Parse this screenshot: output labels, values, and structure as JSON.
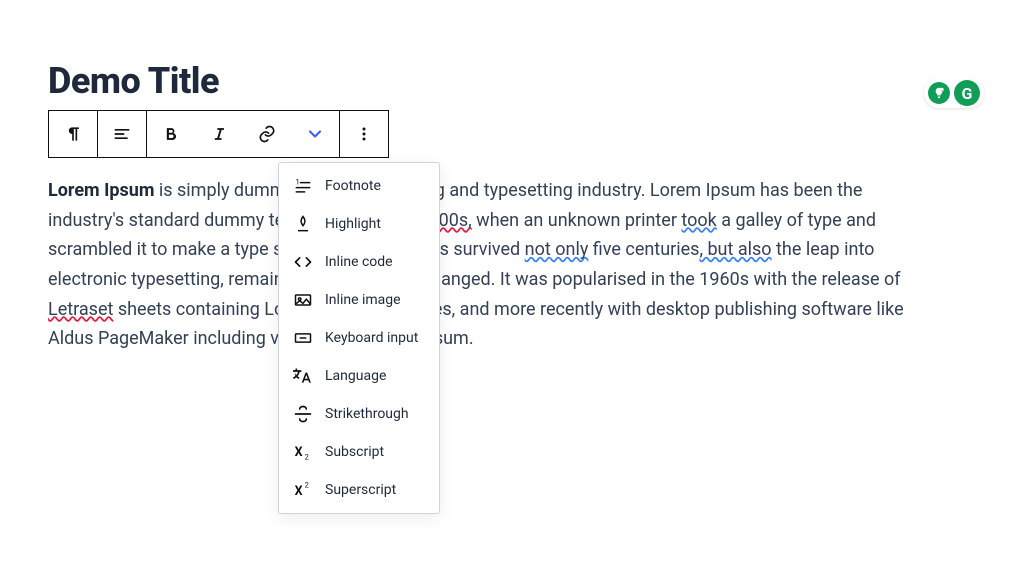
{
  "title": "Demo Title",
  "toolbar": {
    "paragraph_btn": "Paragraph",
    "align_btn": "Align",
    "bold_btn": "Bold",
    "italic_btn": "Italic",
    "link_btn": "Link",
    "more_format_btn": "More formatting",
    "overflow_btn": "Options"
  },
  "body": {
    "lead": "Lorem Ipsum",
    "t1": " is simply dummy text of the printing and typesetting industry. Lorem Ipsum has been the industry's standard dummy text ever since the ",
    "w1": "1500s,",
    "t2": " when an unknown printer ",
    "w2": "took",
    "t3": " a galley of type and scrambled it to make a type specimen book. It has survived ",
    "w3": "not only",
    "t4": " five centuries",
    "w4": ", but also",
    "t5": " the leap into electronic typesetting, remaining essentially unchanged. It was popularised in the 1960s with the release of ",
    "w5": "Letraset",
    "t6": " sheets containing Lorem Ipsum passages, and more recently with desktop publishing software like Aldus PageMaker including versions of Lorem Ipsum."
  },
  "menu": {
    "items": [
      {
        "id": "footnote",
        "label": "Footnote"
      },
      {
        "id": "highlight",
        "label": "Highlight"
      },
      {
        "id": "inline-code",
        "label": "Inline code"
      },
      {
        "id": "inline-image",
        "label": "Inline image"
      },
      {
        "id": "keyboard",
        "label": "Keyboard input"
      },
      {
        "id": "language",
        "label": "Language"
      },
      {
        "id": "strikethrough",
        "label": "Strikethrough"
      },
      {
        "id": "subscript",
        "label": "Subscript"
      },
      {
        "id": "superscript",
        "label": "Superscript"
      }
    ]
  },
  "badges": {
    "grammarly": "G"
  }
}
